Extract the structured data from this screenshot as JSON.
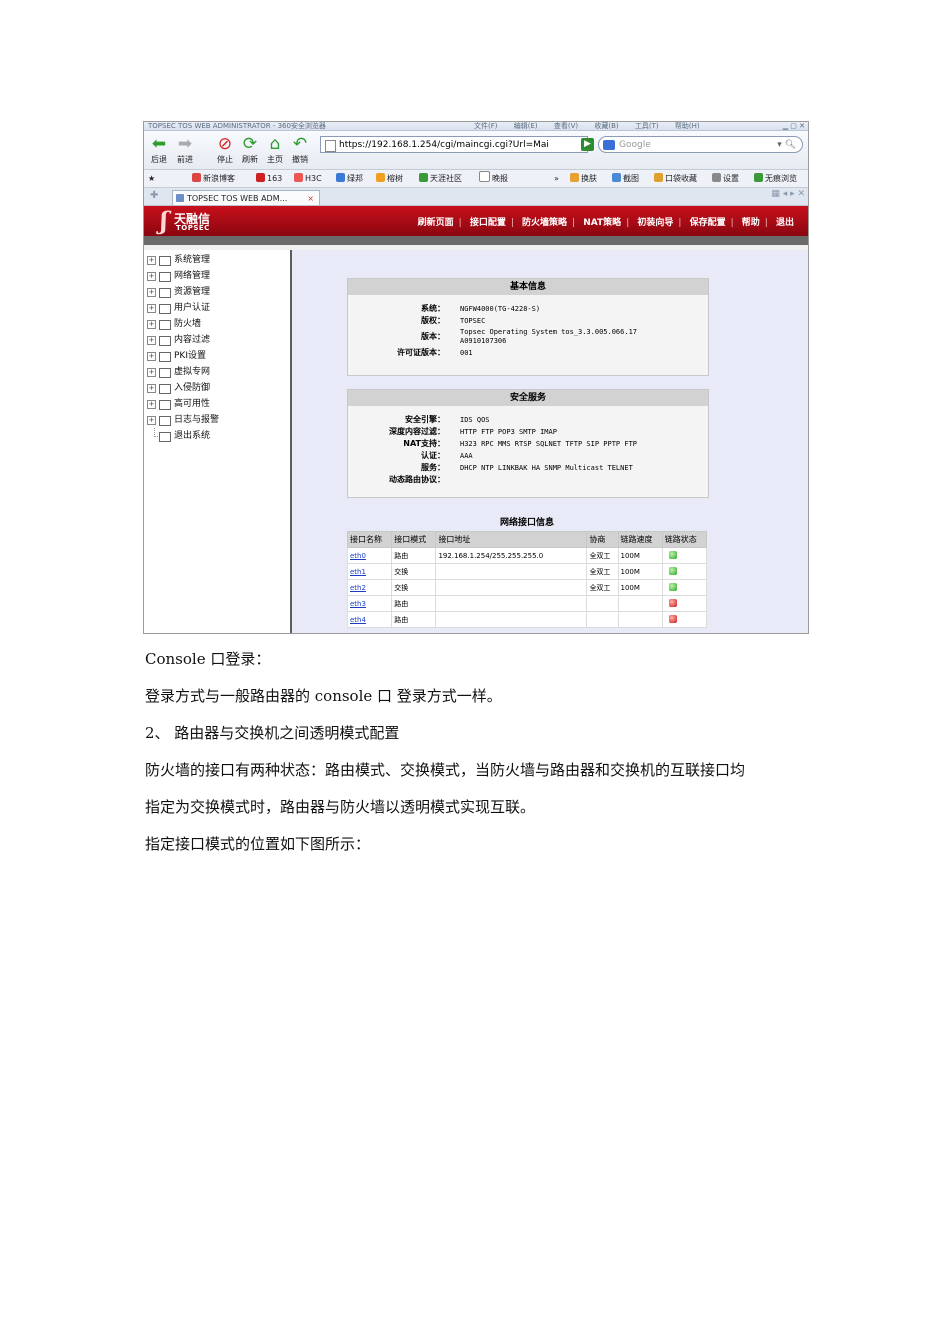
{
  "screenshot": {
    "titlebar": {
      "title": "TOPSEC TOS WEB ADMINISTRATOR - 360安全浏览器",
      "menu": [
        "文件(F)",
        "编辑(E)",
        "查看(V)",
        "收藏(B)",
        "工具(T)",
        "帮助(H)"
      ]
    },
    "nav": {
      "back": "后退",
      "forward": "前进",
      "stop": "停止",
      "refresh": "刷新",
      "home": "主页",
      "undo": "撤销",
      "url": "https://192.168.1.254/cgi/maincgi.cgi?Url=Mai",
      "search_placeholder": "Google"
    },
    "favorites": [
      "新浪博客",
      "163",
      "H3C",
      "绿邦",
      "榕树",
      "天涯社区",
      "晚报",
      "换肤",
      "截图",
      "口袋收藏",
      "设置",
      "无痕浏览"
    ],
    "tab": {
      "label": "TOPSEC TOS WEB ADM...",
      "close": "×"
    },
    "app": {
      "logo_cn": "天融信",
      "logo_en": "TOPSEC",
      "menu": [
        "刷新页面",
        "接口配置",
        "防火墙策略",
        "NAT策略",
        "初装向导",
        "保存配置",
        "帮助",
        "退出"
      ]
    },
    "sidebar": {
      "items": [
        "系统管理",
        "网络管理",
        "资源管理",
        "用户认证",
        "防火墙",
        "内容过滤",
        "PKI设置",
        "虚拟专网",
        "入侵防御",
        "高可用性",
        "日志与报警"
      ],
      "leaf": "退出系统"
    },
    "basic_info": {
      "title": "基本信息",
      "rows": [
        {
          "key": "系统：",
          "value": "NGFW4000(TG-4228-S)"
        },
        {
          "key": "版权：",
          "value": "TOPSEC"
        },
        {
          "key": "版本：",
          "value": "Topsec Operating System tos_3.3.005.066.17",
          "value2": "A0910107306"
        },
        {
          "key": "许可证版本：",
          "value": "001"
        }
      ]
    },
    "security_service": {
      "title": "安全服务",
      "rows": [
        {
          "key": "安全引擎：",
          "value": "IDS QOS"
        },
        {
          "key": "深度内容过滤：",
          "value": "HTTP FTP POP3 SMTP IMAP"
        },
        {
          "key": "NAT支持：",
          "value": "H323 RPC MMS RTSP SQLNET TFTP SIP PPTP FTP"
        },
        {
          "key": "认证：",
          "value": "AAA"
        },
        {
          "key": "服务：",
          "value": "DHCP NTP LINKBAK HA SNMP Multicast TELNET"
        },
        {
          "key": "动态路由协议：",
          "value": ""
        }
      ]
    },
    "net_info": {
      "title": "网络接口信息",
      "headers": [
        "接口名称",
        "接口模式",
        "接口地址",
        "协商",
        "链路速度",
        "链路状态"
      ],
      "rows": [
        {
          "name": "eth0",
          "mode": "路由",
          "addr": "192.168.1.254/255.255.255.0",
          "nego": "全双工",
          "speed": "100M",
          "status": "up"
        },
        {
          "name": "eth1",
          "mode": "交换",
          "addr": "",
          "nego": "全双工",
          "speed": "100M",
          "status": "up"
        },
        {
          "name": "eth2",
          "mode": "交换",
          "addr": "",
          "nego": "全双工",
          "speed": "100M",
          "status": "up"
        },
        {
          "name": "eth3",
          "mode": "路由",
          "addr": "",
          "nego": "",
          "speed": "",
          "status": "down"
        },
        {
          "name": "eth4",
          "mode": "路由",
          "addr": "",
          "nego": "",
          "speed": "",
          "status": "down"
        }
      ]
    }
  },
  "doc": {
    "p1": "Console 口登录：",
    "p2": "登录方式与一般路由器的 console 口  登录方式一样。",
    "p3": "2、  路由器与交换机之间透明模式配置",
    "p4": "防火墙的接口有两种状态：路由模式、交换模式，当防火墙与路由器和交换机的互联接口均",
    "p5": "指定为交换模式时，路由器与防火墙以透明模式实现互联。",
    "p6": "指定接口模式的位置如下图所示："
  },
  "colors": {
    "brand_red": "#c8101c",
    "link": "#1a3cc6",
    "status_up": "#2fa52f",
    "status_down": "#d01818"
  }
}
